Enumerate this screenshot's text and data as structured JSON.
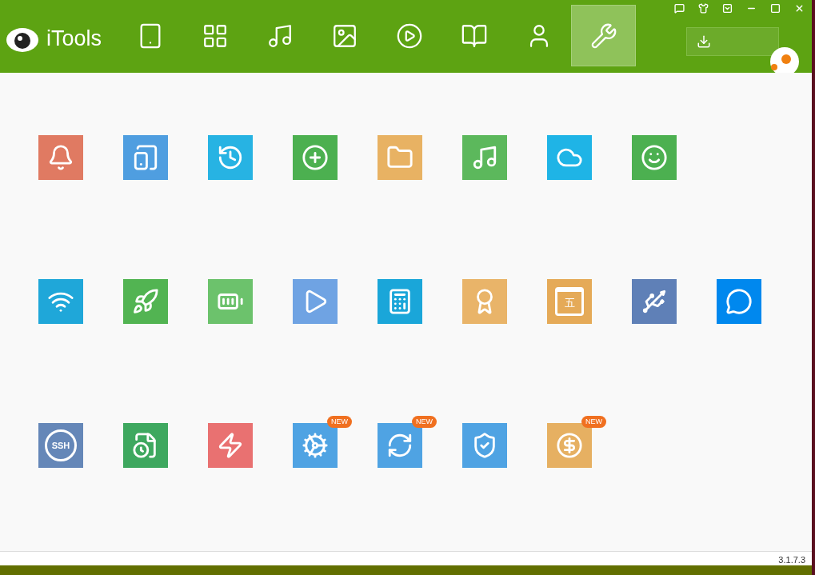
{
  "app": {
    "name": "iTools"
  },
  "nav": [
    {
      "kind": "device",
      "selected": false
    },
    {
      "kind": "apps",
      "selected": false
    },
    {
      "kind": "music",
      "selected": false
    },
    {
      "kind": "photos",
      "selected": false
    },
    {
      "kind": "videos",
      "selected": false
    },
    {
      "kind": "books",
      "selected": false
    },
    {
      "kind": "contacts",
      "selected": false
    },
    {
      "kind": "tools",
      "selected": true
    }
  ],
  "window_controls": [
    {
      "kind": "feedback"
    },
    {
      "kind": "skin"
    },
    {
      "kind": "menu"
    },
    {
      "kind": "minimize"
    },
    {
      "kind": "maximize"
    },
    {
      "kind": "close"
    }
  ],
  "tool_rows": [
    [
      {
        "kind": "bell",
        "color": "#e07a62"
      },
      {
        "kind": "tablet-sync",
        "color": "#4f9ee0"
      },
      {
        "kind": "clock",
        "color": "#27b3e3"
      },
      {
        "kind": "plus-circle",
        "color": "#4cb050"
      },
      {
        "kind": "folder",
        "color": "#e8b263"
      },
      {
        "kind": "music-circle",
        "color": "#5cb85c"
      },
      {
        "kind": "cloud",
        "color": "#1fb4e6"
      },
      {
        "kind": "smile",
        "color": "#4cb050"
      }
    ],
    [
      {
        "kind": "wifi-screen",
        "color": "#1fa7d9"
      },
      {
        "kind": "rocket",
        "color": "#52b452"
      },
      {
        "kind": "battery",
        "color": "#6cc26c"
      },
      {
        "kind": "play-tablet",
        "color": "#6fa3e3"
      },
      {
        "kind": "calculator",
        "color": "#1aa6d9"
      },
      {
        "kind": "award",
        "color": "#e9b469"
      },
      {
        "kind": "window-char",
        "color": "#e5aa58",
        "label": "五"
      },
      {
        "kind": "usb",
        "color": "#5f80b7"
      },
      {
        "kind": "chat-grid",
        "color": "#0088ee"
      }
    ],
    [
      {
        "kind": "ssh",
        "color": "#6587b8",
        "label": "SSH"
      },
      {
        "kind": "file-clock",
        "color": "#3ea85f"
      },
      {
        "kind": "file-bolt",
        "color": "#e97171"
      },
      {
        "kind": "gear",
        "color": "#4fa3e3",
        "badge": "NEW"
      },
      {
        "kind": "refresh-gear",
        "color": "#4fa3e3",
        "badge": "NEW"
      },
      {
        "kind": "shield-lock",
        "color": "#4fa3e3"
      },
      {
        "kind": "money-bag",
        "color": "#e6b062",
        "badge": "NEW"
      }
    ]
  ],
  "status_bar": {
    "version": "3.1.7.3"
  }
}
